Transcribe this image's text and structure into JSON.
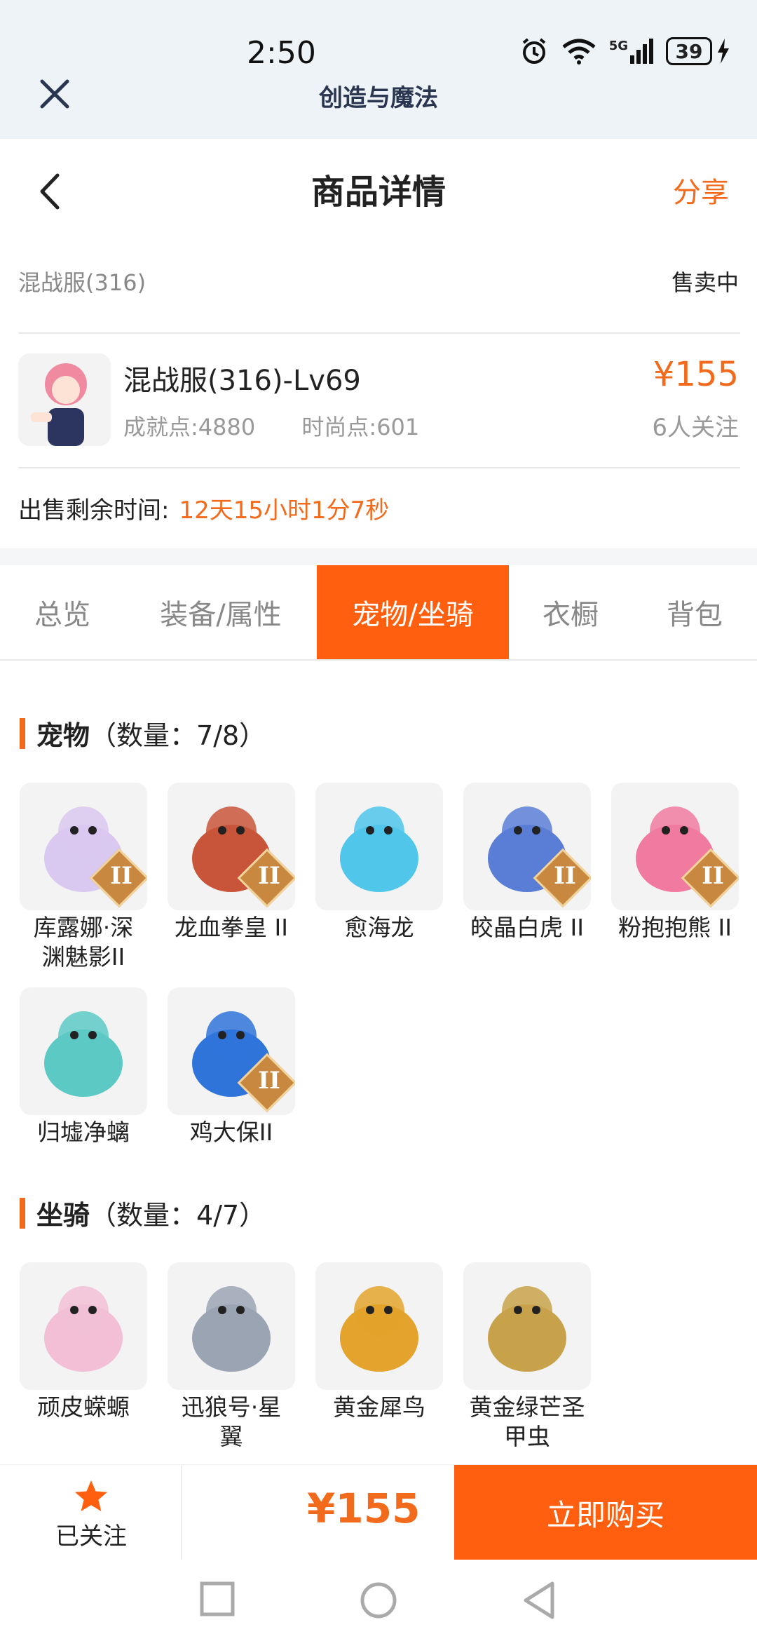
{
  "status_bar": {
    "time": "2:50",
    "battery": "39",
    "signal_label": "5G"
  },
  "window": {
    "title": "创造与魔法"
  },
  "nav": {
    "title": "商品详情",
    "share": "分享"
  },
  "product": {
    "server": "混战服(316)",
    "sale_status": "售卖中",
    "name": "混战服(316)-Lv69",
    "achievement": "成就点:4880",
    "fashion": "时尚点:601",
    "price": "¥155",
    "followers": "6人关注",
    "remaining_label": "出售剩余时间:",
    "remaining_value": "12天15小时1分7秒"
  },
  "tabs": [
    {
      "label": "总览",
      "active": false
    },
    {
      "label": "装备/属性",
      "active": false
    },
    {
      "label": "宠物/坐骑",
      "active": true
    },
    {
      "label": "衣橱",
      "active": false
    },
    {
      "label": "背包",
      "active": false
    }
  ],
  "pets": {
    "title": "宠物",
    "count": "（数量：7/8）",
    "items": [
      {
        "name": "库露娜·深渊魅影II",
        "line1": "库露娜·深",
        "line2": "渊魅影II",
        "badge": "II",
        "color": "#d9c8f0"
      },
      {
        "name": "龙血拳皇 II",
        "line1": "龙血拳皇 II",
        "line2": "",
        "badge": "II",
        "color": "#c8553a"
      },
      {
        "name": "愈海龙",
        "line1": "愈海龙",
        "line2": "",
        "badge": "",
        "color": "#4fc6ea"
      },
      {
        "name": "皎晶白虎 II",
        "line1": "皎晶白虎 II",
        "line2": "",
        "badge": "II",
        "color": "#5a7ed6"
      },
      {
        "name": "粉抱抱熊 II",
        "line1": "粉抱抱熊 II",
        "line2": "",
        "badge": "II",
        "color": "#f07aa0"
      },
      {
        "name": "归墟净螭",
        "line1": "归墟净螭",
        "line2": "",
        "badge": "",
        "color": "#5cc9c4"
      },
      {
        "name": "鸡大保II",
        "line1": "鸡大保II",
        "line2": "",
        "badge": "II",
        "color": "#2f74d9"
      }
    ]
  },
  "mounts": {
    "title": "坐骑",
    "count": "（数量：4/7）",
    "items": [
      {
        "name": "顽皮蝾螈",
        "line1": "顽皮蝾螈",
        "line2": "",
        "color": "#f2bfd6"
      },
      {
        "name": "迅狼号·星翼",
        "line1": "迅狼号·星",
        "line2": "翼",
        "color": "#9aa4b3"
      },
      {
        "name": "黄金犀鸟",
        "line1": "黄金犀鸟",
        "line2": "",
        "color": "#e3a32c"
      },
      {
        "name": "黄金绿芒圣甲虫",
        "line1": "黄金绿芒圣",
        "line2": "甲虫",
        "color": "#c8a24a"
      }
    ]
  },
  "bottom": {
    "follow_label": "已关注",
    "price": "¥155",
    "buy_label": "立即购买"
  },
  "colors": {
    "accent": "#ff5f0f",
    "price": "#f26a1b"
  }
}
